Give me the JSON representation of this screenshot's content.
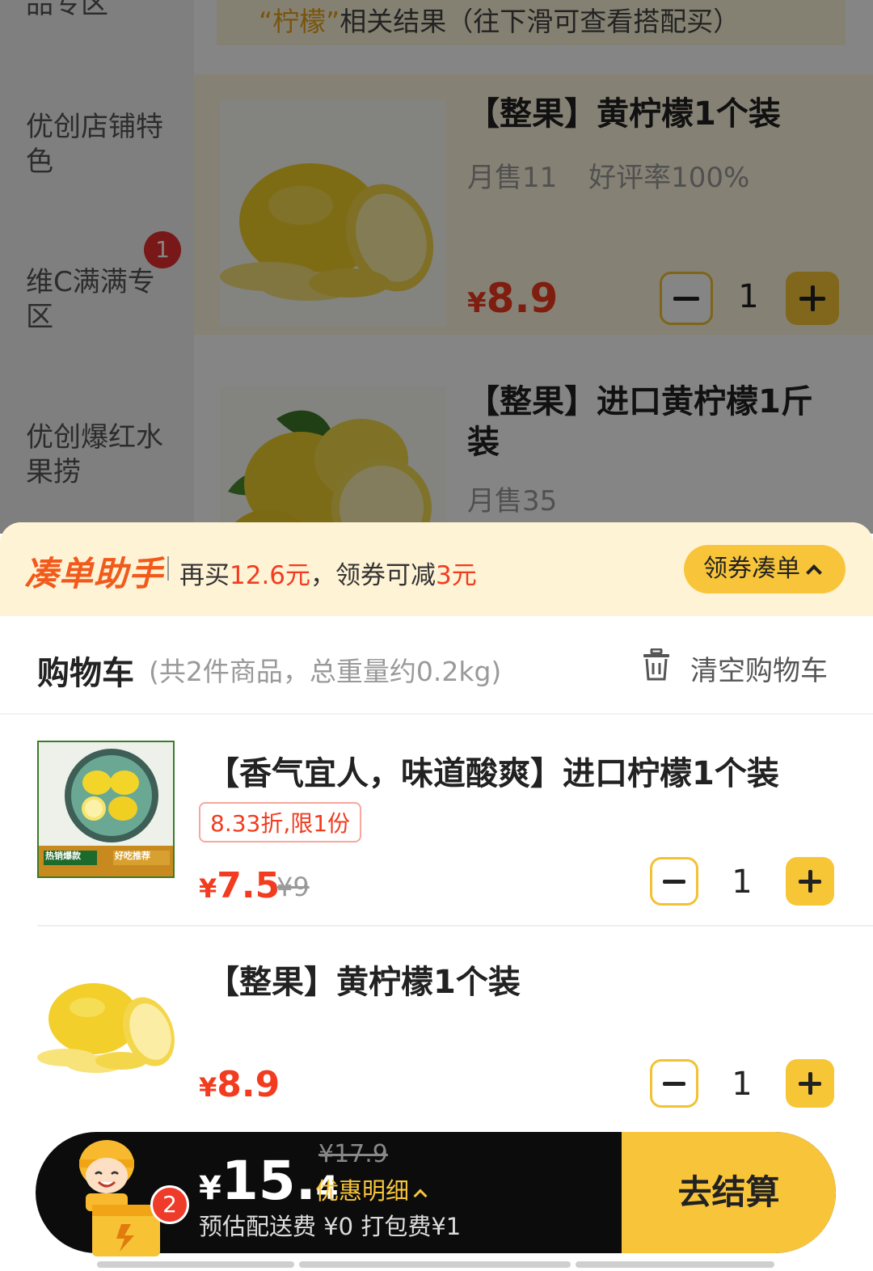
{
  "sidebar": {
    "items": [
      {
        "label": "品专区"
      },
      {
        "label": "优创店铺特色"
      },
      {
        "label": "维C满满专区",
        "badge": "1"
      },
      {
        "label": "优创爆红水果捞"
      }
    ]
  },
  "results_banner": {
    "keyword": "“柠檬”",
    "text": "相关结果（往下滑可查看搭配买）"
  },
  "products": [
    {
      "title": "【整果】黄柠檬1个装",
      "monthly_sales": "月售11",
      "rating": "好评率100%",
      "currency": "¥",
      "price": "8.9",
      "qty": "1"
    },
    {
      "title": "【整果】进口黄柠檬1斤装",
      "monthly_sales": "月售35"
    }
  ],
  "helper": {
    "logo": "凑单助手",
    "text_prefix": "再买",
    "amount": "12.6元",
    "text_middle": "，领券可减",
    "discount": "3元",
    "button_label": "领券凑单"
  },
  "cart": {
    "title": "购物车",
    "summary": "(共2件商品，总重量约0.2kg)",
    "clear_label": "清空购物车",
    "items": [
      {
        "title": "【香气宜人，味道酸爽】进口柠檬1个装",
        "tag": "8.33折,限1份",
        "currency": "¥",
        "price": "7.5",
        "original_price": "¥9",
        "qty": "1",
        "thumb_labels": [
          "热销爆款",
          "好吃推荐"
        ]
      },
      {
        "title": "【整果】黄柠檬1个装",
        "currency": "¥",
        "price": "8.9",
        "qty": "1"
      }
    ]
  },
  "checkout": {
    "currency": "¥",
    "total_int": "15.",
    "total_dec": "4",
    "original_total": "¥17.9",
    "discount_detail": "优惠明细",
    "fees": "预估配送费 ¥0 打包费¥1",
    "button_label": "去结算",
    "badge": "2"
  },
  "colors": {
    "accent_yellow": "#f8c53a",
    "price_red": "#f23b1f",
    "helper_bg": "#fff3d6",
    "checkout_bar": "#0c0c0c"
  }
}
